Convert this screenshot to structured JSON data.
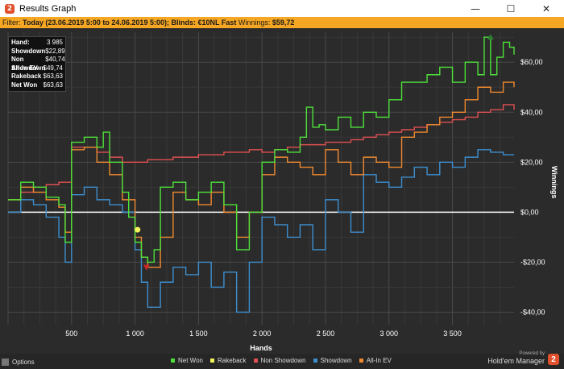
{
  "window": {
    "title": "Results Graph",
    "app_icon": "holdem-manager-icon",
    "controls": {
      "minimize": "—",
      "maximize": "☐",
      "close": "✕"
    }
  },
  "filter": {
    "label": "Filter:",
    "date_range": "Today (23.06.2019 5:00 to 24.06.2019 5:00);",
    "blinds": "Blinds: €10NL Fast",
    "winnings_label": "Winnings:",
    "winnings_value": "$59,72"
  },
  "stats": [
    {
      "label": "Hand:",
      "value": "3 985"
    },
    {
      "label": "Showdown",
      "value": "$22,89"
    },
    {
      "label": "Non Showdown",
      "value": "$40,74"
    },
    {
      "label": "All-In EV",
      "value": "$49,74"
    },
    {
      "label": "Rakeback",
      "value": "$63,63"
    },
    {
      "label": "Net Won",
      "value": "$63,63"
    }
  ],
  "footer": {
    "options_label": "Options",
    "powered_by": "Powered by",
    "brand": "Hold'em Manager",
    "brand_logo": "2"
  },
  "colors": {
    "background": "#2b2b2b",
    "net_won": "#4ee13a",
    "rakeback": "#f3f35a",
    "non_showdown": "#e05050",
    "showdown": "#3d8fd0",
    "all_in_ev": "#f08a30",
    "filter_bar": "#f5a623"
  },
  "chart_data": {
    "type": "line",
    "xlabel": "Hands",
    "ylabel": "Winnings",
    "xlim": [
      0,
      3985
    ],
    "ylim": [
      -45,
      72
    ],
    "x_ticks": [
      500,
      1000,
      1500,
      2000,
      2500,
      3000,
      3500
    ],
    "x_tick_labels": [
      "500",
      "1 000",
      "1 500",
      "2 000",
      "2 500",
      "3 000",
      "3 500"
    ],
    "y_ticks": [
      -40,
      -20,
      0,
      20,
      40,
      60
    ],
    "y_tick_labels": [
      "-$40,00",
      "-$20,00",
      "$0,00",
      "$20,00",
      "$40,00",
      "$60,00"
    ],
    "grid": true,
    "legend_position": "bottom",
    "series": [
      {
        "name": "Net Won",
        "color": "#4ee13a",
        "x": [
          0,
          100,
          200,
          300,
          400,
          450,
          500,
          600,
          700,
          750,
          800,
          900,
          950,
          1000,
          1050,
          1100,
          1150,
          1200,
          1300,
          1400,
          1500,
          1600,
          1700,
          1800,
          1900,
          2000,
          2100,
          2200,
          2300,
          2350,
          2400,
          2450,
          2500,
          2600,
          2700,
          2800,
          2900,
          3000,
          3100,
          3200,
          3300,
          3400,
          3500,
          3600,
          3700,
          3750,
          3800,
          3850,
          3900,
          3950,
          3985
        ],
        "y": [
          5,
          12,
          10,
          6,
          3,
          -12,
          28,
          30,
          26,
          32,
          20,
          8,
          -2,
          -12,
          -18,
          -20,
          -15,
          10,
          12,
          5,
          8,
          12,
          3,
          -15,
          0,
          20,
          25,
          24,
          30,
          42,
          34,
          35,
          33,
          38,
          34,
          40,
          38,
          45,
          52,
          52,
          55,
          58,
          52,
          60,
          55,
          70,
          55,
          62,
          68,
          66,
          63
        ]
      },
      {
        "name": "Rakeback",
        "color": "#f3f35a",
        "x": [
          1020
        ],
        "y": [
          -7
        ]
      },
      {
        "name": "Non Showdown",
        "color": "#e05050",
        "x": [
          0,
          100,
          200,
          300,
          400,
          500,
          600,
          700,
          800,
          900,
          1000,
          1100,
          1200,
          1300,
          1400,
          1500,
          1600,
          1700,
          1800,
          1900,
          2000,
          2100,
          2200,
          2300,
          2400,
          2500,
          2600,
          2700,
          2800,
          2900,
          3000,
          3100,
          3200,
          3300,
          3400,
          3500,
          3600,
          3700,
          3800,
          3900,
          3985
        ],
        "y": [
          5,
          8,
          10,
          11,
          12,
          26,
          26,
          24,
          22,
          20,
          20,
          21,
          21,
          22,
          22,
          23,
          23,
          24,
          24,
          25,
          24,
          25,
          26,
          27,
          27,
          28,
          28,
          29,
          30,
          31,
          32,
          33,
          34,
          35,
          36,
          37,
          38,
          40,
          41,
          43,
          41
        ]
      },
      {
        "name": "Showdown",
        "color": "#3d8fd0",
        "x": [
          0,
          100,
          200,
          300,
          400,
          450,
          500,
          600,
          700,
          800,
          900,
          1000,
          1050,
          1100,
          1200,
          1300,
          1400,
          1500,
          1600,
          1700,
          1800,
          1900,
          2000,
          2100,
          2200,
          2300,
          2400,
          2500,
          2600,
          2700,
          2800,
          2900,
          3000,
          3100,
          3200,
          3300,
          3400,
          3500,
          3600,
          3700,
          3800,
          3900,
          3985
        ],
        "y": [
          0,
          5,
          3,
          -2,
          -10,
          -20,
          7,
          10,
          5,
          3,
          0,
          -15,
          -28,
          -38,
          -28,
          -22,
          -25,
          -20,
          -30,
          -24,
          -40,
          -20,
          -2,
          -5,
          -10,
          -5,
          -15,
          5,
          0,
          -8,
          15,
          12,
          10,
          14,
          18,
          15,
          20,
          18,
          22,
          25,
          24,
          23,
          23
        ]
      },
      {
        "name": "All-In EV",
        "color": "#f08a30",
        "x": [
          0,
          100,
          200,
          300,
          400,
          450,
          500,
          600,
          700,
          800,
          900,
          1000,
          1050,
          1100,
          1200,
          1300,
          1400,
          1500,
          1600,
          1700,
          1800,
          1900,
          2000,
          2100,
          2200,
          2300,
          2400,
          2500,
          2600,
          2700,
          2800,
          2900,
          3000,
          3100,
          3200,
          3300,
          3400,
          3500,
          3600,
          3700,
          3800,
          3900,
          3985
        ],
        "y": [
          5,
          10,
          8,
          5,
          2,
          -8,
          25,
          26,
          20,
          15,
          5,
          -10,
          -18,
          -22,
          -10,
          8,
          5,
          3,
          8,
          0,
          -10,
          0,
          15,
          22,
          20,
          18,
          15,
          25,
          20,
          15,
          22,
          20,
          18,
          30,
          32,
          35,
          38,
          40,
          45,
          50,
          48,
          52,
          50
        ]
      }
    ],
    "markers": [
      {
        "series": "Net Won",
        "x": 3800,
        "y": 70,
        "shape": "triangle-up"
      },
      {
        "series": "Non Showdown",
        "x": 1090,
        "y": -22,
        "shape": "triangle-down"
      },
      {
        "series": "Rakeback",
        "x": 1020,
        "y": -7,
        "shape": "star"
      }
    ],
    "legend": [
      "Net Won",
      "Rakeback",
      "Non Showdown",
      "Showdown",
      "All-In EV"
    ]
  }
}
